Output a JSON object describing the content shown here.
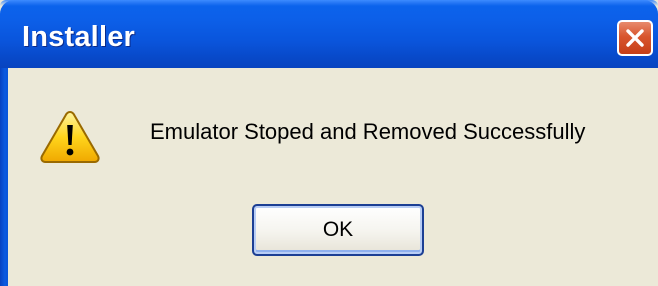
{
  "window": {
    "title": "Installer"
  },
  "dialog": {
    "message": "Emulator Stoped and Removed Successfully",
    "icon": "warning-icon",
    "ok_label": "OK"
  },
  "colors": {
    "titlebar": "#0a55dc",
    "body": "#ece9d8",
    "close_button": "#d8562e",
    "button_border": "#1c3f94"
  }
}
